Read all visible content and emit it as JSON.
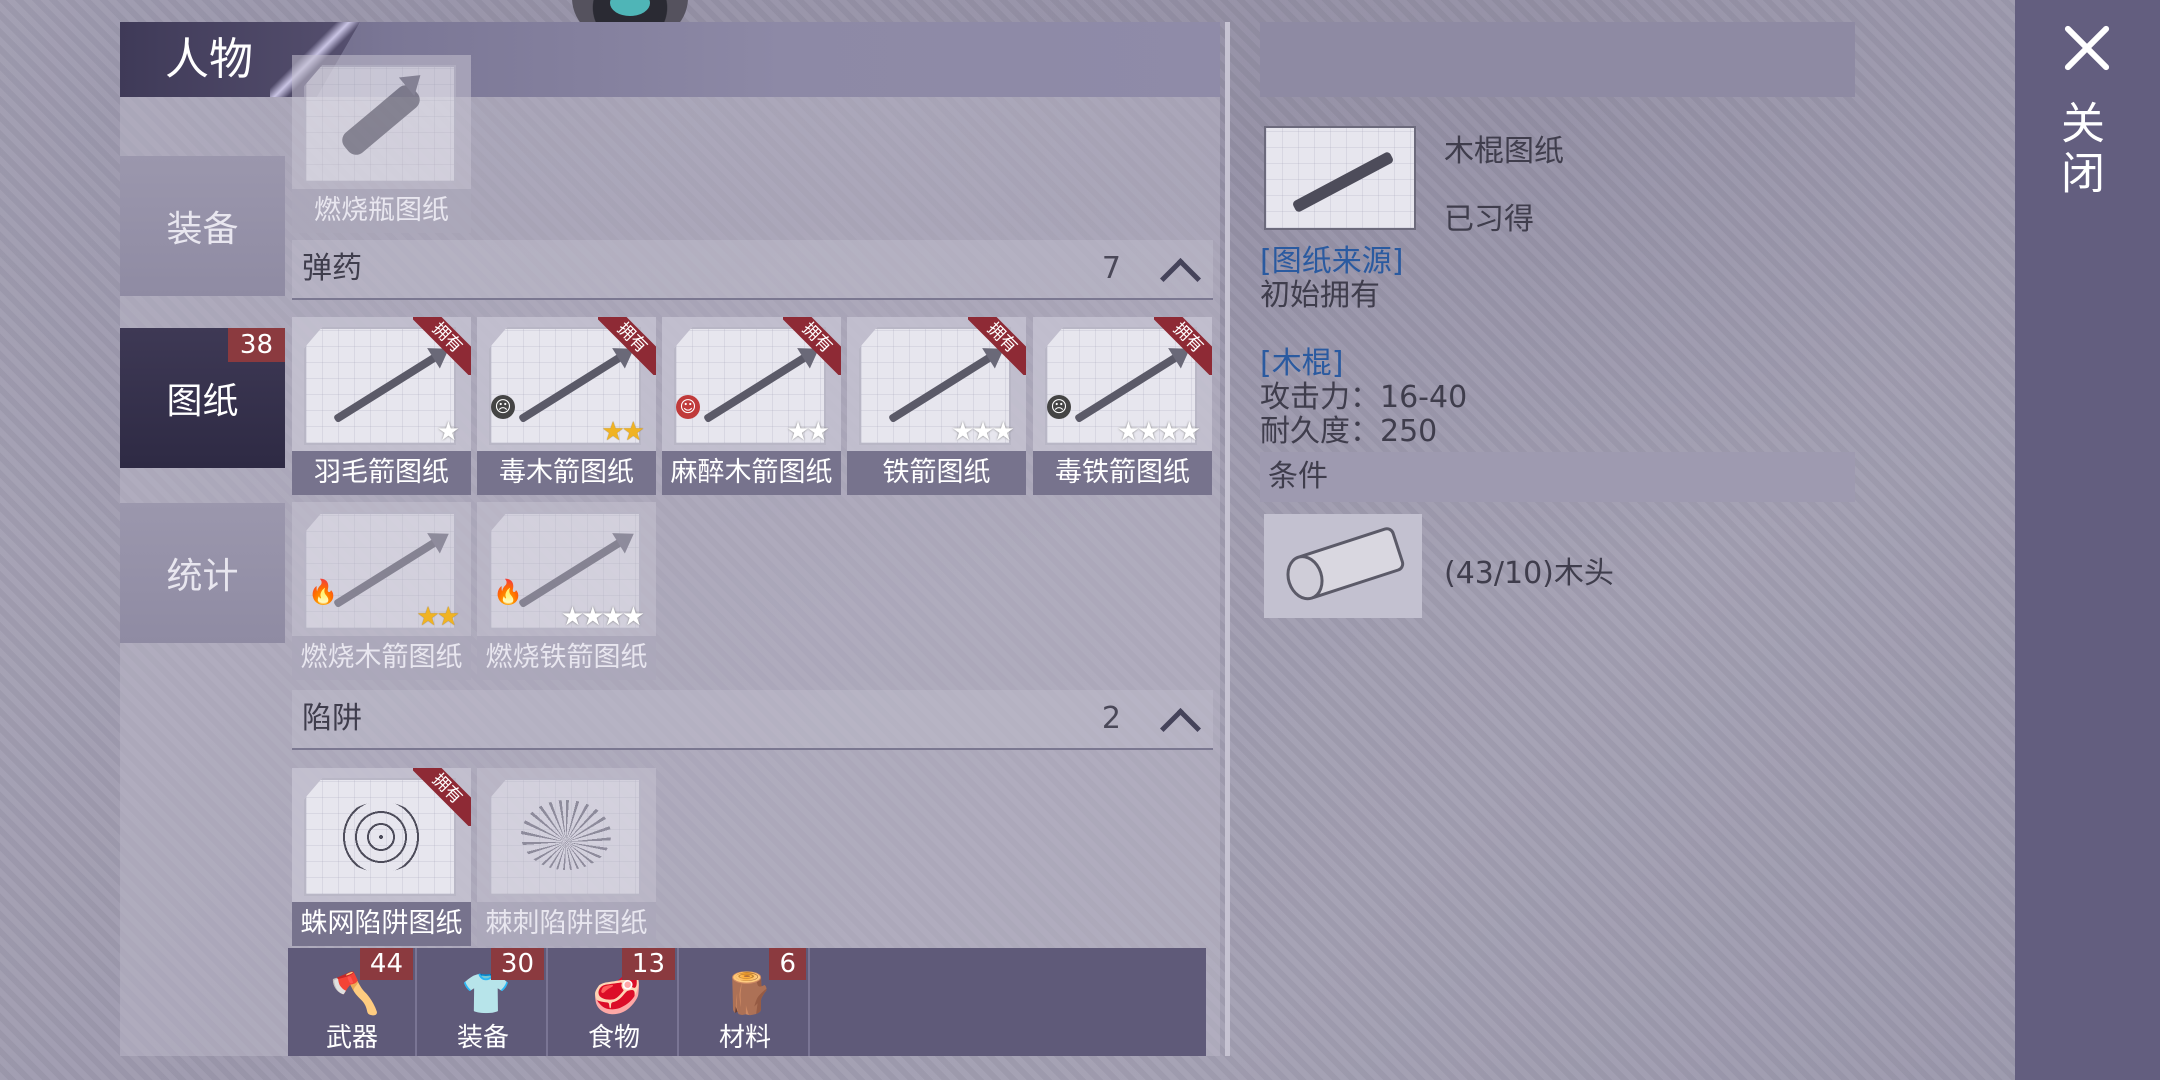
{
  "header": {
    "title": "人物"
  },
  "sidebar": {
    "items": [
      {
        "label": "装备",
        "badge": null,
        "active": false
      },
      {
        "label": "图纸",
        "badge": "38",
        "active": true
      },
      {
        "label": "统计",
        "badge": null,
        "active": false
      }
    ]
  },
  "list": {
    "top_item": {
      "label": "燃烧瓶图纸"
    },
    "sections": [
      {
        "name": "弹药",
        "count": "7",
        "items": [
          {
            "label": "羽毛箭图纸",
            "owned": true,
            "stars_gold": 0,
            "stars_white": 1
          },
          {
            "label": "毒木箭图纸",
            "owned": true,
            "stars_gold": 2,
            "stars_white": 0
          },
          {
            "label": "麻醉木箭图纸",
            "owned": true,
            "stars_gold": 0,
            "stars_white": 2
          },
          {
            "label": "铁箭图纸",
            "owned": true,
            "stars_gold": 0,
            "stars_white": 3
          },
          {
            "label": "毒铁箭图纸",
            "owned": true,
            "stars_gold": 0,
            "stars_white": 4
          },
          {
            "label": "燃烧木箭图纸",
            "owned": false,
            "stars_gold": 2,
            "stars_white": 0
          },
          {
            "label": "燃烧铁箭图纸",
            "owned": false,
            "stars_gold": 0,
            "stars_white": 4
          }
        ]
      },
      {
        "name": "陷阱",
        "count": "2",
        "items": [
          {
            "label": "蛛网陷阱图纸",
            "owned": true
          },
          {
            "label": "棘刺陷阱图纸",
            "owned": false
          }
        ]
      }
    ],
    "owned_tag": "拥有"
  },
  "bottom_tabs": [
    {
      "label": "武器",
      "badge": "44",
      "icon": "axe-icon"
    },
    {
      "label": "装备",
      "badge": "30",
      "icon": "shirt-icon"
    },
    {
      "label": "食物",
      "badge": "13",
      "icon": "meat-icon"
    },
    {
      "label": "材料",
      "badge": "6",
      "icon": "wood-icon"
    }
  ],
  "detail": {
    "name": "木棍图纸",
    "status": "已习得",
    "source_label": "[图纸来源]",
    "source_value": "初始拥有",
    "item_label": "[木棍]",
    "attack": "攻击力：16-40",
    "durability": "耐久度：250",
    "conditions_label": "条件",
    "requirement": "(43/10)木头"
  },
  "close": {
    "label": "关闭"
  },
  "colors": {
    "badge": "#8b3a3f",
    "owned_ribbon": "#8e2a35",
    "link_blue": "#2a5aa0",
    "star_gold": "#f0b323"
  }
}
